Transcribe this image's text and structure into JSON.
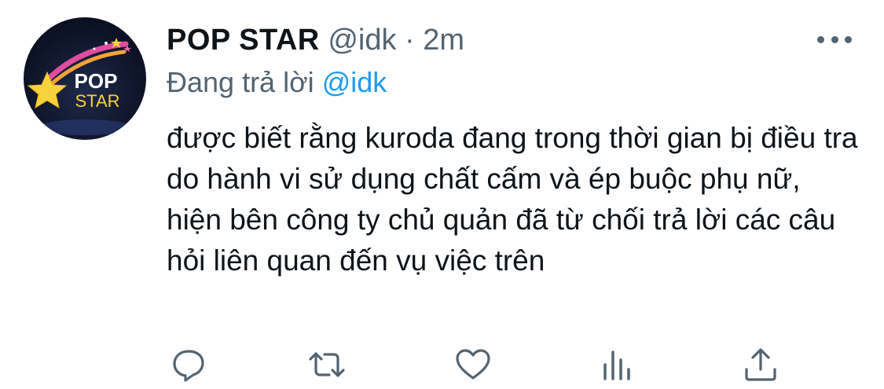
{
  "tweet": {
    "author": {
      "display_name": "POP STAR",
      "handle": "@idk",
      "avatar_text_top": "POP",
      "avatar_text_bottom": "STAR"
    },
    "separator": "·",
    "time": "2m",
    "reply_prefix": "Đang trả lời",
    "reply_to": "@idk",
    "text": "được biết rằng kuroda đang trong thời gian bị điều tra do hành vi sử dụng chất cấm và ép buộc phụ nữ, hiện bên công ty chủ quản đã từ chối trả lời các câu hỏi liên quan đến vụ việc trên"
  },
  "actions": [
    {
      "name": "reply",
      "icon": "comment-icon"
    },
    {
      "name": "retweet",
      "icon": "retweet-icon"
    },
    {
      "name": "like",
      "icon": "heart-icon"
    },
    {
      "name": "analytics",
      "icon": "bar-chart-icon"
    },
    {
      "name": "share",
      "icon": "share-icon"
    }
  ],
  "colors": {
    "text": "#0f1419",
    "muted": "#536471",
    "link": "#1d9bf0"
  }
}
